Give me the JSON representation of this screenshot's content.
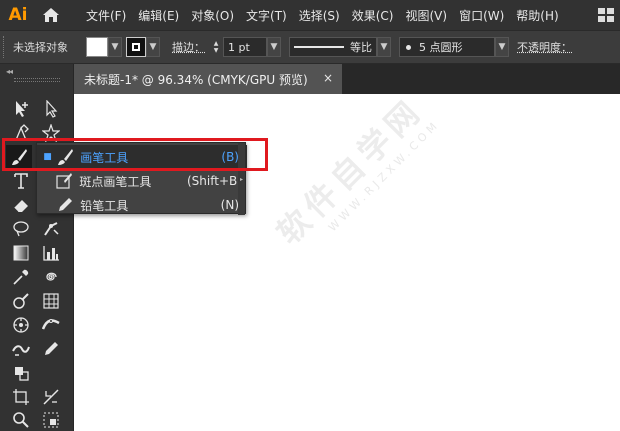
{
  "app": {
    "logo_text": "Ai",
    "brand_color": "#FF9A00"
  },
  "menu": {
    "items": [
      "文件(F)",
      "编辑(E)",
      "对象(O)",
      "文字(T)",
      "选择(S)",
      "效果(C)",
      "视图(V)",
      "窗口(W)",
      "帮助(H)"
    ]
  },
  "control_bar": {
    "selection_status": "未选择对象",
    "stroke_label": "描边：",
    "stroke_weight": "1 pt",
    "stroke_style_label": "等比",
    "brush_label": "5 点圆形",
    "opacity_label": "不透明度："
  },
  "document_tab": {
    "title": "未标题-1* @ 96.34% (CMYK/GPU 预览)",
    "close_glyph": "×"
  },
  "flyout": {
    "items": [
      {
        "label": "画笔工具",
        "shortcut": "(B)",
        "selected": true,
        "bullet": "■",
        "icon": "paintbrush-icon"
      },
      {
        "label": "斑点画笔工具",
        "shortcut": "(Shift+B)",
        "selected": false,
        "bullet": "",
        "icon": "blob-brush-icon"
      },
      {
        "label": "铅笔工具",
        "shortcut": "(N)",
        "selected": false,
        "bullet": "",
        "icon": "pencil-icon"
      }
    ],
    "arrow_glyph": "▸"
  },
  "toolbar": {
    "collapse_glyph": "◂◂",
    "tools": [
      "selection-tool",
      "direct-selection-tool",
      "pen-tool",
      "star-tool",
      "paintbrush-tool",
      "type-tool",
      "eraser-tool",
      "lasso-tool",
      "puppet-warp-tool",
      "gradient-tool",
      "graph-tool",
      "eyedropper-tool",
      "spiral-tool",
      "live-paint-tool",
      "mesh-tool",
      "symbol-sprayer-tool",
      "width-tool",
      "pencil-tool",
      "shape-builder-tool",
      "artboard-tool",
      "slice-tool",
      "zoom-tool",
      "print-tiling-tool"
    ]
  },
  "watermark": {
    "text": "软件自学网",
    "url_text": "WWW.RJZXW.COM"
  },
  "colors": {
    "highlight": "#E0191F",
    "selected_text": "#4DA3FF"
  }
}
